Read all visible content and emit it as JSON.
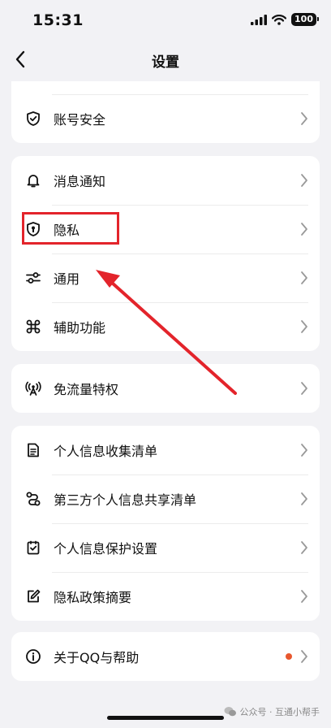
{
  "status_bar": {
    "time": "15:31",
    "battery": "100"
  },
  "nav": {
    "title": "设置"
  },
  "sections": [
    {
      "rows": [
        {
          "label": "账号安全",
          "icon": "shield-check-icon"
        }
      ]
    },
    {
      "rows": [
        {
          "label": "消息通知",
          "icon": "bell-icon"
        },
        {
          "label": "隐私",
          "icon": "privacy-shield-icon"
        },
        {
          "label": "通用",
          "icon": "sliders-icon"
        },
        {
          "label": "辅助功能",
          "icon": "command-icon"
        }
      ]
    },
    {
      "rows": [
        {
          "label": "免流量特权",
          "icon": "signal-tower-icon"
        }
      ]
    },
    {
      "rows": [
        {
          "label": "个人信息收集清单",
          "icon": "document-list-icon"
        },
        {
          "label": "第三方个人信息共享清单",
          "icon": "share-link-icon"
        },
        {
          "label": "个人信息保护设置",
          "icon": "checkbox-doc-icon"
        },
        {
          "label": "隐私政策摘要",
          "icon": "edit-doc-icon"
        }
      ]
    },
    {
      "rows": [
        {
          "label": "关于QQ与帮助",
          "icon": "info-icon",
          "badge_color": "#e8572e"
        }
      ]
    }
  ],
  "annotation": {
    "highlight_color": "#e3242b",
    "arrow_color": "#e3242b"
  },
  "watermark": {
    "text": "公众号 · 互通小帮手"
  }
}
